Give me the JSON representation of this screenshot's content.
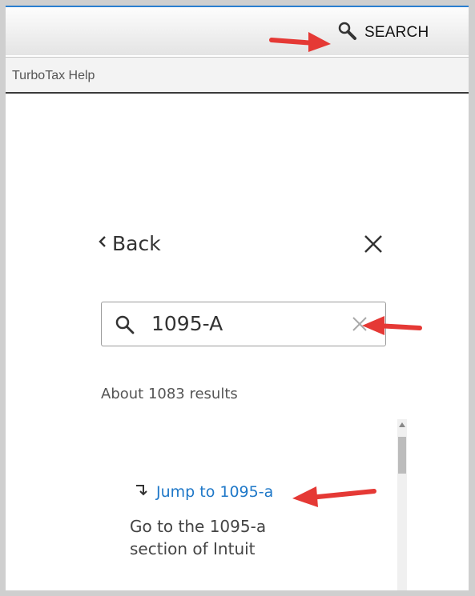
{
  "header": {
    "search_label": "SEARCH",
    "search_icon": "magnifier-icon"
  },
  "tab": {
    "title": "TurboTax Help"
  },
  "panel": {
    "back_label": "Back",
    "close_icon": "close-icon",
    "search": {
      "value": "1095-A",
      "clear_icon": "clear-icon"
    },
    "results_text": "About 1083 results",
    "result": {
      "jump_label": "Jump to 1095-a",
      "jump_icon": "jump-arrow-icon",
      "description": "Go to the 1095-a section of Intuit"
    }
  },
  "annotations": {
    "arrow_color": "#e53935"
  },
  "colors": {
    "link": "#1f78c8",
    "accent_top": "#2a7fd0"
  }
}
